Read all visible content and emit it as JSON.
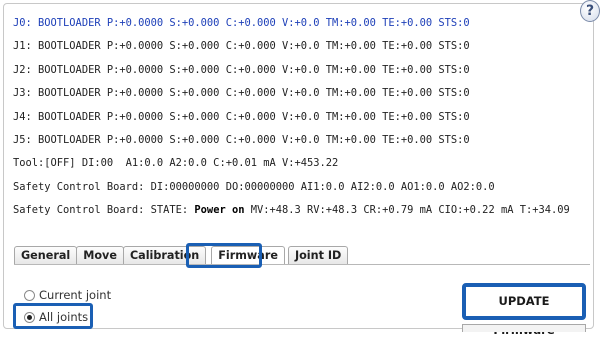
{
  "help_icon": "?",
  "status_lines": [
    "J0: BOOTLOADER P:+0.0000 S:+0.000 C:+0.000 V:+0.0 TM:+0.00 TE:+0.00 STS:0",
    "J1: BOOTLOADER P:+0.0000 S:+0.000 C:+0.000 V:+0.0 TM:+0.00 TE:+0.00 STS:0",
    "J2: BOOTLOADER P:+0.0000 S:+0.000 C:+0.000 V:+0.0 TM:+0.00 TE:+0.00 STS:0",
    "J3: BOOTLOADER P:+0.0000 S:+0.000 C:+0.000 V:+0.0 TM:+0.00 TE:+0.00 STS:0",
    "J4: BOOTLOADER P:+0.0000 S:+0.000 C:+0.000 V:+0.0 TM:+0.00 TE:+0.00 STS:0",
    "J5: BOOTLOADER P:+0.0000 S:+0.000 C:+0.000 V:+0.0 TM:+0.00 TE:+0.00 STS:0",
    "Tool:[OFF] DI:00  A1:0.0 A2:0.0 C:+0.01 mA V:+453.22",
    "Safety Control Board: DI:00000000 DO:00000000 AI1:0.0 AI2:0.0 AO1:0.0 AO2:0.0"
  ],
  "safety_state": {
    "prefix": "Safety Control Board: STATE: ",
    "state": "Power on",
    "suffix": " MV:+48.3 RV:+48.3 CR:+0.79 mA CIO:+0.22 mA T:+34.09"
  },
  "tabs": [
    "General",
    "Move",
    "Calibration",
    "Firmware",
    "Joint ID"
  ],
  "active_tab": "Firmware",
  "radio_options": {
    "current_joint": "Current joint",
    "all_joints": "All joints",
    "selected": "All joints"
  },
  "update_button": "UPDATE Firmware",
  "colors": {
    "highlight": "#1a5fb4",
    "selected_line": "#1d3fb8"
  }
}
